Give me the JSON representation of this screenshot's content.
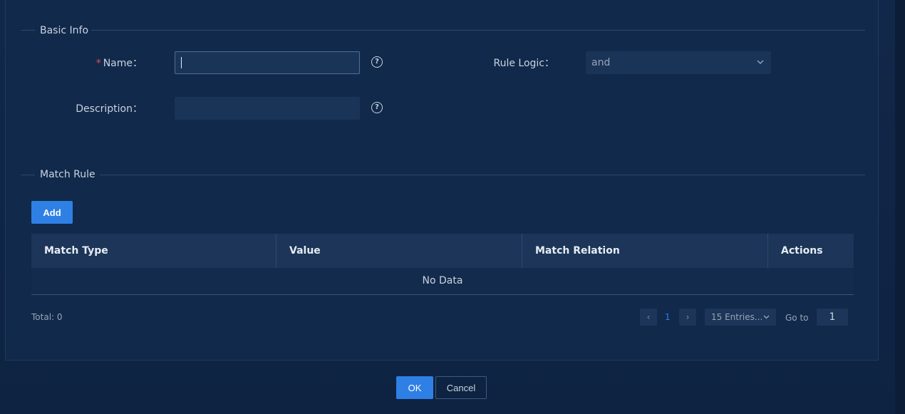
{
  "basic_info": {
    "section_title": "Basic Info",
    "name_label": "Name",
    "name_required_mark": "*",
    "name_value": "",
    "description_label": "Description",
    "description_value": "",
    "rule_logic_label": "Rule Logic",
    "rule_logic_value": "and",
    "help_glyph": "?",
    "label_suffix": "："
  },
  "match_rule": {
    "section_title": "Match Rule",
    "add_label": "Add",
    "columns": [
      "Match Type",
      "Value",
      "Match Relation",
      "Actions"
    ],
    "empty_text": "No Data"
  },
  "pagination": {
    "total_text": "Total: 0",
    "current_page": "1",
    "page_size": "15 Entries...",
    "goto_label": "Go to",
    "goto_value": "1",
    "prev_glyph": "‹",
    "next_glyph": "›"
  },
  "footer": {
    "ok_label": "OK",
    "cancel_label": "Cancel"
  },
  "icons": {
    "help": "help-circle-icon",
    "chevron": "chevron-down-icon"
  },
  "colors": {
    "primary": "#2f80e5",
    "background": "#11294b",
    "required": "#e84a4a"
  }
}
